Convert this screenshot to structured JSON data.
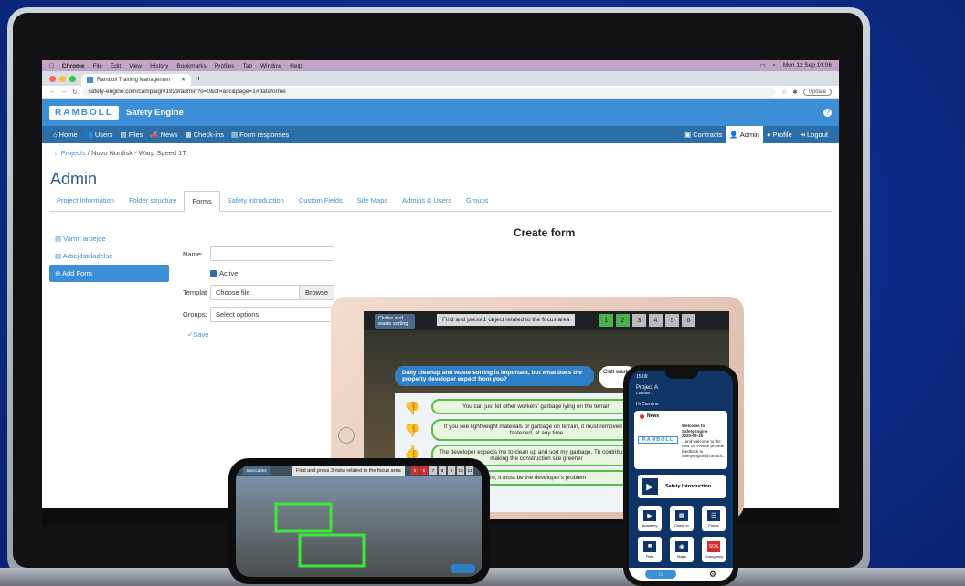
{
  "menubar": {
    "apple": "",
    "app": "Chrome",
    "items": [
      "File",
      "Edit",
      "View",
      "History",
      "Bookmarks",
      "Profiles",
      "Tab",
      "Window",
      "Help"
    ],
    "clock": "Mon 12 Sep 10:06"
  },
  "browser": {
    "tab_title": "Ramboll Training Managemen",
    "url": "safety-engine.com/campaign/1929/admin?o=0&ot=asc&page=1#dataforme",
    "update": "Update"
  },
  "app": {
    "logo": "RAMBOLL",
    "name": "Safety Engine",
    "help": "?"
  },
  "nav": {
    "home": "Home",
    "users": "Users",
    "files": "Files",
    "news": "News",
    "checkins": "Check-ins",
    "form_responses": "Form responses",
    "contracts": "Contracts",
    "admin": "Admin",
    "profile": "Profile",
    "logout": "Logout"
  },
  "breadcrumb": {
    "projects": "Projects",
    "sep": "/",
    "current": "Novo Nordisk - Warp Speed 1T"
  },
  "page": {
    "title": "Admin"
  },
  "tabs": [
    "Project Information",
    "Folder structure",
    "Forms",
    "Safety introduction",
    "Custom Fields",
    "Site Maps",
    "Admins & Users",
    "Groups"
  ],
  "sidebar": {
    "items": [
      "Varmt arbejde",
      "Arbejdstilladelse"
    ],
    "add": "Add Form"
  },
  "form": {
    "heading": "Create form",
    "name_label": "Name:",
    "active_label": "Active",
    "template_label": "Templat",
    "file_placeholder": "Choose file",
    "browse": "Browse",
    "groups_label": "Groups:",
    "groups_placeholder": "Select options",
    "save": "Save"
  },
  "tablet": {
    "chip": "Clutter and waste sorting",
    "prompt": "Find and press 1 object related to the focus area",
    "nums": [
      "1",
      "2",
      "3",
      "4",
      "5",
      "6"
    ],
    "question": "Daily cleanup and waste sorting is important, but what does the property developer expect from you?",
    "clutter": "Clutt waste",
    "answers": [
      "You can just let other workers' garbage lying on the terrain",
      "If you see lightweight materials or garbage on terrain, it must removed or fastened, at any time",
      "The developer expects me to clean up and sort my garbage. Th contribute to making the construction site greener",
      "are, it must be the developer's problem"
    ]
  },
  "small_phone": {
    "chip": "Barricades",
    "prompt": "Find and press 3 risks related to the focus area",
    "nums": [
      "5",
      "6",
      "7",
      "8",
      "9",
      "10",
      "11"
    ]
  },
  "big_phone": {
    "time": "15:09",
    "project": "Project A",
    "contractor": "Contract 1",
    "greeting": "Hi Caroline",
    "news_label": "News",
    "news_logo": "RAMBOLL",
    "news_title": "Welcome to SafetyEngine",
    "news_date": "2020-09-15",
    "news_body": "...and welcome to the new UI. Please provide feedback to safetyengine@rambol...",
    "safety_intro": "Safety Introduction",
    "tiles": [
      {
        "label": "Academy",
        "icon": "▶"
      },
      {
        "label": "Check in",
        "icon": "▦"
      },
      {
        "label": "Forms",
        "icon": "☰"
      },
      {
        "label": "Files",
        "icon": "■"
      },
      {
        "label": "Maps",
        "icon": "◉"
      },
      {
        "label": "Emergency",
        "icon": "SOS"
      }
    ]
  }
}
